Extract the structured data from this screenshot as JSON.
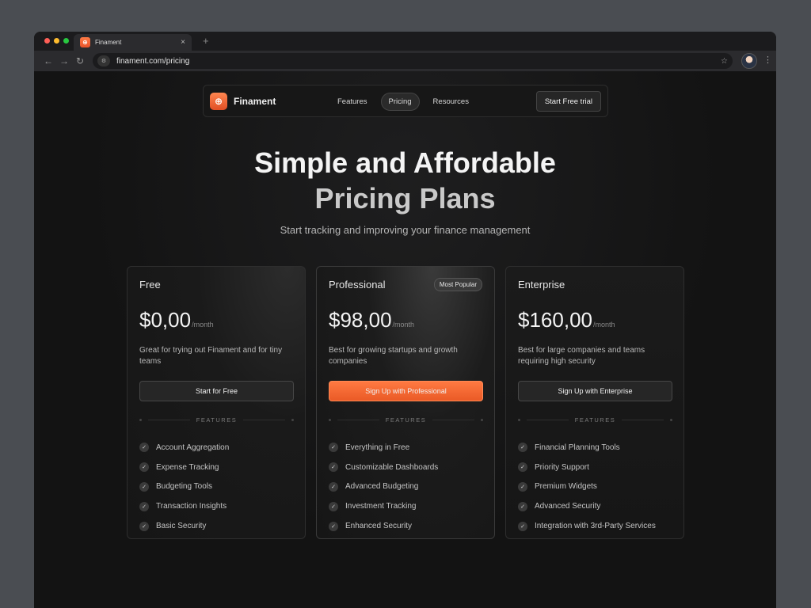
{
  "browser": {
    "tab_title": "Finament",
    "tab_close": "×",
    "new_tab": "+",
    "url": "finament.com/pricing",
    "traffic_colors": [
      "#ff5f57",
      "#febc2e",
      "#28c840"
    ]
  },
  "nav": {
    "brand": "Finament",
    "links": [
      "Features",
      "Pricing",
      "Resources"
    ],
    "active_link": "Pricing",
    "cta": "Start Free trial"
  },
  "hero": {
    "title_line1": "Simple and Affordable",
    "title_line2": "Pricing Plans",
    "subtitle": "Start tracking and improving your finance management"
  },
  "plans": [
    {
      "name": "Free",
      "price": "$0,00",
      "period": "/month",
      "description": "Great for trying out Finament and for tiny teams",
      "cta": "Start for Free",
      "features_label": "FEATURES",
      "features": [
        "Account Aggregation",
        "Expense Tracking",
        "Budgeting Tools",
        "Transaction Insights",
        "Basic Security"
      ]
    },
    {
      "name": "Professional",
      "badge": "Most Popular",
      "price": "$98,00",
      "period": "/month",
      "description": "Best for growing startups and growth companies",
      "cta": "Sign Up with Professional",
      "features_label": "FEATURES",
      "features": [
        "Everything in Free",
        "Customizable Dashboards",
        "Advanced Budgeting",
        "Investment Tracking",
        "Enhanced Security"
      ]
    },
    {
      "name": "Enterprise",
      "price": "$160,00",
      "period": "/month",
      "description": "Best for large companies and teams requiring high security",
      "cta": "Sign Up with Enterprise",
      "features_label": "FEATURES",
      "features": [
        "Financial Planning Tools",
        "Priority Support",
        "Premium Widgets",
        "Advanced Security",
        "Integration with 3rd-Party Services"
      ]
    }
  ],
  "colors": {
    "accent": "#ea5a26",
    "background": "#141414"
  }
}
